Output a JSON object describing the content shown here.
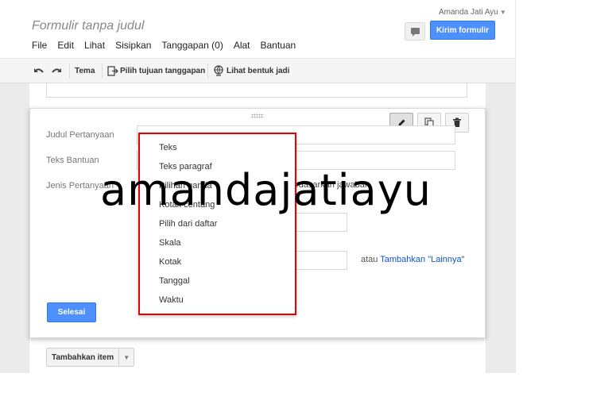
{
  "form": {
    "title": "Formulir tanpa judul"
  },
  "menubar": [
    "File",
    "Edit",
    "Lihat",
    "Sisipkan",
    "Tanggapan (0)",
    "Alat",
    "Bantuan"
  ],
  "user": {
    "name": "Amanda Jati Ayu"
  },
  "header": {
    "send_label": "Kirim formulir"
  },
  "toolbar": {
    "theme": "Tema",
    "destination": "Pilih tujuan tanggapan",
    "preview": "Lihat bentuk jadi"
  },
  "question": {
    "title_label": "Judul Pertanyaan",
    "help_label": "Teks Bantuan",
    "type_label": "Jenis Pertanyaan",
    "type_suffix_partial": "rdasarkan jawaban",
    "other_text": "atau ",
    "other_link": "Tambahkan \"Lainnya\"",
    "done_label": "Selesai"
  },
  "type_menu": {
    "options": [
      "Teks",
      "Teks paragraf",
      "Pilihan ganda",
      "Kotak centang",
      "Pilih dari daftar",
      "Skala",
      "Kotak",
      "Tanggal",
      "Waktu"
    ]
  },
  "add_item": {
    "label": "Tambahkan item"
  },
  "watermark": {
    "text": "amandajatiayu"
  }
}
